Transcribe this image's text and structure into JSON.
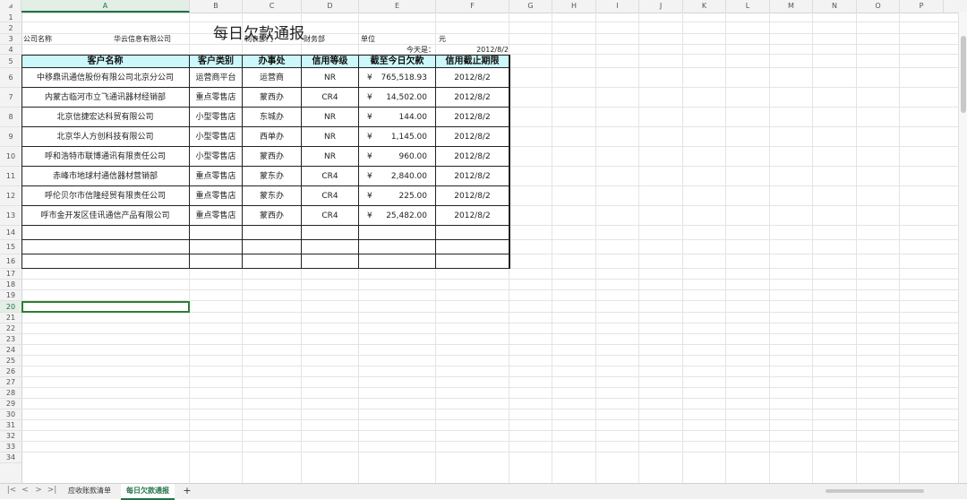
{
  "columns": [
    "A",
    "B",
    "C",
    "D",
    "E",
    "F",
    "G",
    "H",
    "I",
    "J",
    "K",
    "L",
    "M",
    "N",
    "O",
    "P"
  ],
  "rows": [
    "1",
    "2",
    "3",
    "4",
    "5",
    "6",
    "7",
    "8",
    "9",
    "10",
    "11",
    "12",
    "13",
    "14",
    "15",
    "16",
    "17",
    "18",
    "19",
    "20",
    "21",
    "22",
    "23",
    "24",
    "25",
    "26",
    "27",
    "28",
    "29",
    "30",
    "31",
    "32",
    "33",
    "34"
  ],
  "active_row": "20",
  "active_col": "A",
  "report": {
    "title": "每日欠款通报",
    "company_label": "公司名称",
    "company_name": "华云信息有限公司",
    "dept_label": "制表部门",
    "dept_name": "财务部",
    "unit_label": "单位",
    "unit_value": "元",
    "today_label": "今天是：",
    "today_value": "2012/8/2"
  },
  "table": {
    "headers": [
      "客户名称",
      "客户类别",
      "办事处",
      "信用等级",
      "截至今日欠款",
      "信用截止期限"
    ],
    "currency_symbol": "¥",
    "rows": [
      {
        "name": "中移鼎讯通信股份有限公司北京分公司",
        "category": "运营商平台",
        "office": "运营商",
        "credit": "NR",
        "amount": "765,518.93",
        "deadline": "2012/8/2"
      },
      {
        "name": "内蒙古临河市立飞通讯器材经销部",
        "category": "重点零售店",
        "office": "蒙西办",
        "credit": "CR4",
        "amount": "14,502.00",
        "deadline": "2012/8/2"
      },
      {
        "name": "北京信捷宏达科贸有限公司",
        "category": "小型零售店",
        "office": "东城办",
        "credit": "NR",
        "amount": "144.00",
        "deadline": "2012/8/2"
      },
      {
        "name": "北京华人方创科技有限公司",
        "category": "小型零售店",
        "office": "西单办",
        "credit": "NR",
        "amount": "1,145.00",
        "deadline": "2012/8/2"
      },
      {
        "name": "呼和浩特市联博通讯有限责任公司",
        "category": "小型零售店",
        "office": "蒙西办",
        "credit": "NR",
        "amount": "960.00",
        "deadline": "2012/8/2"
      },
      {
        "name": "赤峰市地球村通信器材营销部",
        "category": "重点零售店",
        "office": "蒙东办",
        "credit": "CR4",
        "amount": "2,840.00",
        "deadline": "2012/8/2"
      },
      {
        "name": "呼伦贝尔市信隆经贸有限责任公司",
        "category": "重点零售店",
        "office": "蒙东办",
        "credit": "CR4",
        "amount": "225.00",
        "deadline": "2012/8/2"
      },
      {
        "name": "呼市金开发区佳讯通信产品有限公司",
        "category": "重点零售店",
        "office": "蒙西办",
        "credit": "CR4",
        "amount": "25,482.00",
        "deadline": "2012/8/2"
      }
    ]
  },
  "sheets": [
    {
      "label": "应收账款清单",
      "active": false
    },
    {
      "label": "每日欠款通报",
      "active": true
    }
  ],
  "add_sheet_label": "+",
  "nav_buttons": [
    "|<",
    "<",
    ">",
    ">|"
  ]
}
